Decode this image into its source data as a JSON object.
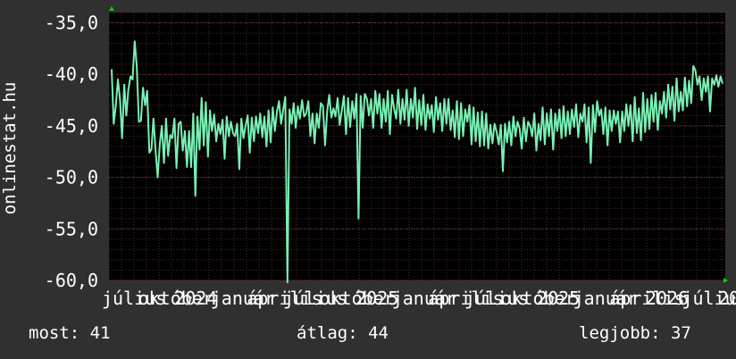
{
  "colors": {
    "background": "#303030",
    "plot_background": "#000000",
    "grid": "#4a2a2a",
    "line": "#78f0b4",
    "text": "#ffffff",
    "axis_arrow": "#00d000"
  },
  "chart_data": {
    "type": "line",
    "ylabel": "onlinestat.hu",
    "ylim": [
      -60,
      -34
    ],
    "y_ticks": [
      "-35,0",
      "-40,0",
      "-45,0",
      "-50,0",
      "-55,0",
      "-60,0"
    ],
    "y_tick_values": [
      -35,
      -40,
      -45,
      -50,
      -55,
      -60
    ],
    "x_tick_labels": [
      "július",
      "október",
      "2024",
      "január",
      "április",
      "július",
      "október",
      "2025",
      "január",
      "április",
      "július",
      "október",
      "2025",
      "január",
      "április",
      "2026",
      "július",
      "20"
    ],
    "grid": true,
    "series": [
      {
        "values": [
          -39.5,
          -44.8,
          -43.0,
          -40.5,
          -42.5,
          -46.2,
          -41.0,
          -44.0,
          -41.5,
          -40.2,
          -40.5,
          -36.8,
          -39.2,
          -44.6,
          -44.5,
          -41.3,
          -43.0,
          -41.6,
          -47.6,
          -47.3,
          -44.3,
          -47.4,
          -50.0,
          -46.8,
          -45.0,
          -48.6,
          -44.3,
          -47.9,
          -45.9,
          -46.2,
          -44.3,
          -49.1,
          -44.8,
          -44.6,
          -47.4,
          -45.5,
          -49.0,
          -45.5,
          -49.0,
          -43.8,
          -51.8,
          -44.1,
          -47.3,
          -42.3,
          -46.9,
          -42.7,
          -48.0,
          -43.5,
          -45.5,
          -43.9,
          -46.5,
          -44.8,
          -45.8,
          -44.4,
          -48.2,
          -44.1,
          -46.0,
          -44.6,
          -45.7,
          -46.0,
          -44.8,
          -49.2,
          -44.3,
          -46.2,
          -45.0,
          -44.0,
          -47.6,
          -44.2,
          -46.5,
          -44.1,
          -45.7,
          -43.8,
          -46.1,
          -44.1,
          -47.0,
          -43.5,
          -46.6,
          -43.2,
          -45.5,
          -43.6,
          -42.6,
          -44.8,
          -43.4,
          -42.2,
          -60.2,
          -43.4,
          -44.8,
          -42.8,
          -45.2,
          -43.1,
          -44.3,
          -42.5,
          -44.1,
          -43.8,
          -42.6,
          -46.0,
          -43.8,
          -46.7,
          -43.8,
          -45.2,
          -42.8,
          -43.1,
          -46.9,
          -43.6,
          -42.0,
          -44.2,
          -43.3,
          -44.1,
          -42.3,
          -44.9,
          -43.5,
          -42.1,
          -45.8,
          -42.3,
          -45.1,
          -42.6,
          -44.3,
          -41.9,
          -54.0,
          -42.1,
          -45.2,
          -41.9,
          -42.4,
          -44.0,
          -42.4,
          -45.2,
          -41.6,
          -43.8,
          -41.9,
          -45.2,
          -42.4,
          -44.6,
          -41.6,
          -45.8,
          -42.0,
          -43.3,
          -44.3,
          -41.5,
          -44.8,
          -42.4,
          -44.4,
          -41.5,
          -45.0,
          -42.4,
          -44.2,
          -41.3,
          -45.3,
          -42.5,
          -44.9,
          -42.0,
          -45.4,
          -42.9,
          -44.3,
          -43.0,
          -45.6,
          -42.2,
          -44.4,
          -42.8,
          -45.5,
          -42.4,
          -44.8,
          -42.4,
          -45.4,
          -43.5,
          -46.1,
          -42.6,
          -46.3,
          -42.8,
          -46.0,
          -43.4,
          -44.6,
          -43.0,
          -46.8,
          -43.2,
          -46.5,
          -43.7,
          -47.0,
          -43.6,
          -46.9,
          -43.8,
          -47.2,
          -44.9,
          -46.7,
          -44.8,
          -45.6,
          -46.8,
          -44.9,
          -49.4,
          -44.8,
          -46.6,
          -44.6,
          -46.9,
          -44.1,
          -46.0,
          -44.6,
          -45.3,
          -47.2,
          -44.2,
          -46.5,
          -44.6,
          -45.0,
          -46.0,
          -43.8,
          -47.4,
          -44.8,
          -46.4,
          -43.2,
          -46.8,
          -43.8,
          -46.0,
          -43.4,
          -47.3,
          -43.8,
          -45.5,
          -43.4,
          -46.2,
          -43.1,
          -46.0,
          -43.6,
          -45.8,
          -43.4,
          -45.1,
          -42.9,
          -46.1,
          -43.8,
          -44.6,
          -42.9,
          -46.6,
          -43.2,
          -48.6,
          -43.0,
          -45.6,
          -42.6,
          -44.0,
          -43.4,
          -45.8,
          -43.2,
          -46.9,
          -43.5,
          -45.5,
          -43.5,
          -44.8,
          -43.6,
          -46.6,
          -43.6,
          -45.5,
          -42.9,
          -45.0,
          -43.0,
          -46.5,
          -42.2,
          -45.7,
          -43.3,
          -46.4,
          -41.8,
          -45.6,
          -42.4,
          -45.3,
          -42.0,
          -44.6,
          -41.8,
          -45.4,
          -42.6,
          -43.8,
          -41.7,
          -44.2,
          -41.0,
          -43.4,
          -41.2,
          -44.5,
          -40.4,
          -43.6,
          -41.7,
          -43.5,
          -40.3,
          -43.1,
          -40.6,
          -42.8,
          -39.2,
          -39.6,
          -41.0,
          -40.2,
          -42.5,
          -40.4,
          -41.7,
          -40.2,
          -43.6,
          -40.4,
          -41.0,
          -40.1,
          -41.2,
          -40.2,
          -40.9
        ]
      }
    ]
  },
  "stats": {
    "current": "most: 41",
    "average": "átlag: 44",
    "best": "legjobb: 37"
  }
}
